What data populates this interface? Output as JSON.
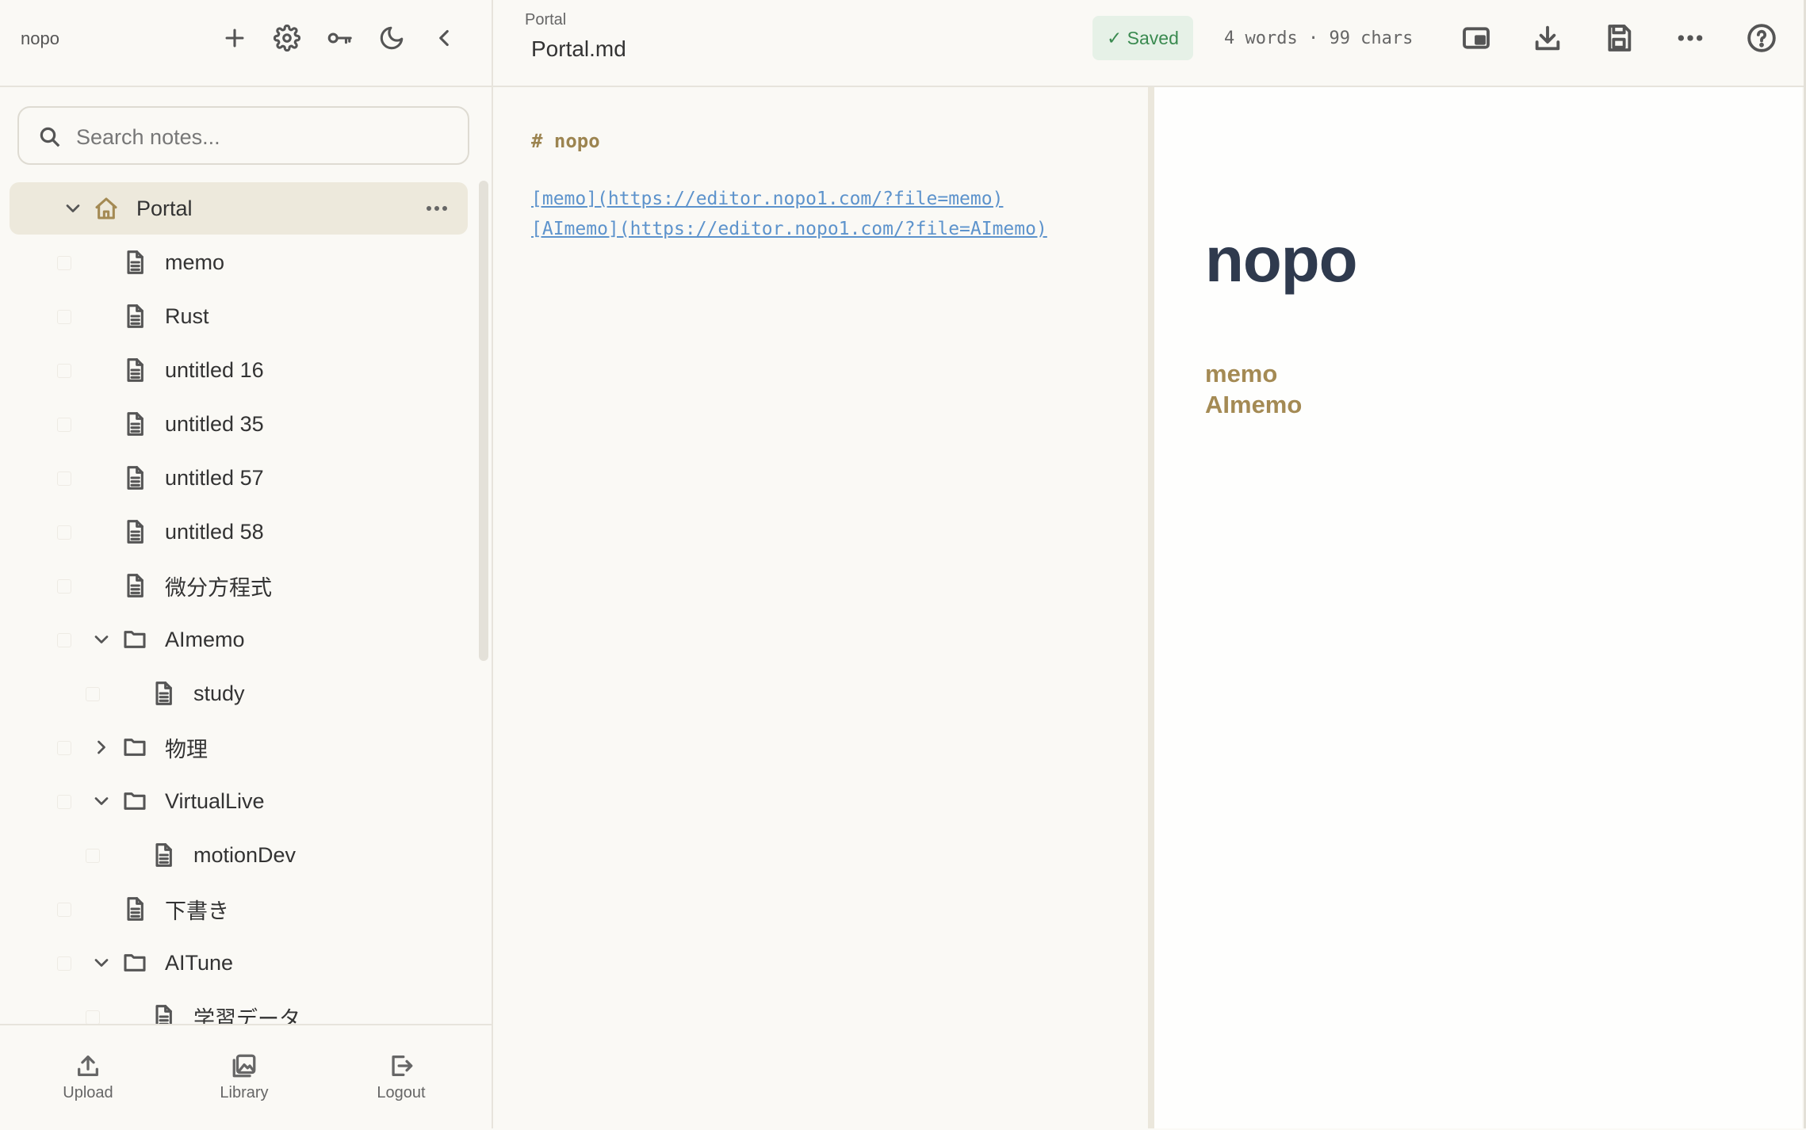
{
  "sidebar": {
    "brand": "nopo",
    "search_placeholder": "Search notes...",
    "tree": [
      {
        "label": "Portal",
        "type": "home",
        "selected": true,
        "expanded": true
      },
      {
        "label": "memo",
        "type": "file"
      },
      {
        "label": "Rust",
        "type": "file"
      },
      {
        "label": "untitled 16",
        "type": "file"
      },
      {
        "label": "untitled 35",
        "type": "file"
      },
      {
        "label": "untitled 57",
        "type": "file"
      },
      {
        "label": "untitled 58",
        "type": "file"
      },
      {
        "label": "微分方程式",
        "type": "file"
      },
      {
        "label": "AImemo",
        "type": "folder",
        "expanded": true
      },
      {
        "label": "study",
        "type": "file",
        "nested": true
      },
      {
        "label": "物理",
        "type": "folder",
        "expanded": false
      },
      {
        "label": "VirtualLive",
        "type": "folder",
        "expanded": true
      },
      {
        "label": "motionDev",
        "type": "file",
        "nested": true
      },
      {
        "label": "下書き",
        "type": "file"
      },
      {
        "label": "AITune",
        "type": "folder",
        "expanded": true
      },
      {
        "label": "学習データ",
        "type": "file",
        "nested": true
      }
    ],
    "footer": {
      "upload": "Upload",
      "library": "Library",
      "logout": "Logout"
    }
  },
  "header": {
    "breadcrumb": "Portal",
    "filename": "Portal.md",
    "saved": "✓ Saved",
    "stats": "4 words · 99 chars"
  },
  "editor": {
    "line1": "# nopo",
    "line2": "[memo](https://editor.nopo1.com/?file=memo)",
    "line3": "[AImemo](https://editor.nopo1.com/?file=AImemo)"
  },
  "preview": {
    "title": "nopo",
    "link1": "memo",
    "link2": "AImemo"
  },
  "colors": {
    "accent": "#a48a54",
    "link": "#5d93cc",
    "saved_bg": "#e6f1e7",
    "saved_text": "#3a8a50",
    "selected_row": "#ede9dc"
  }
}
